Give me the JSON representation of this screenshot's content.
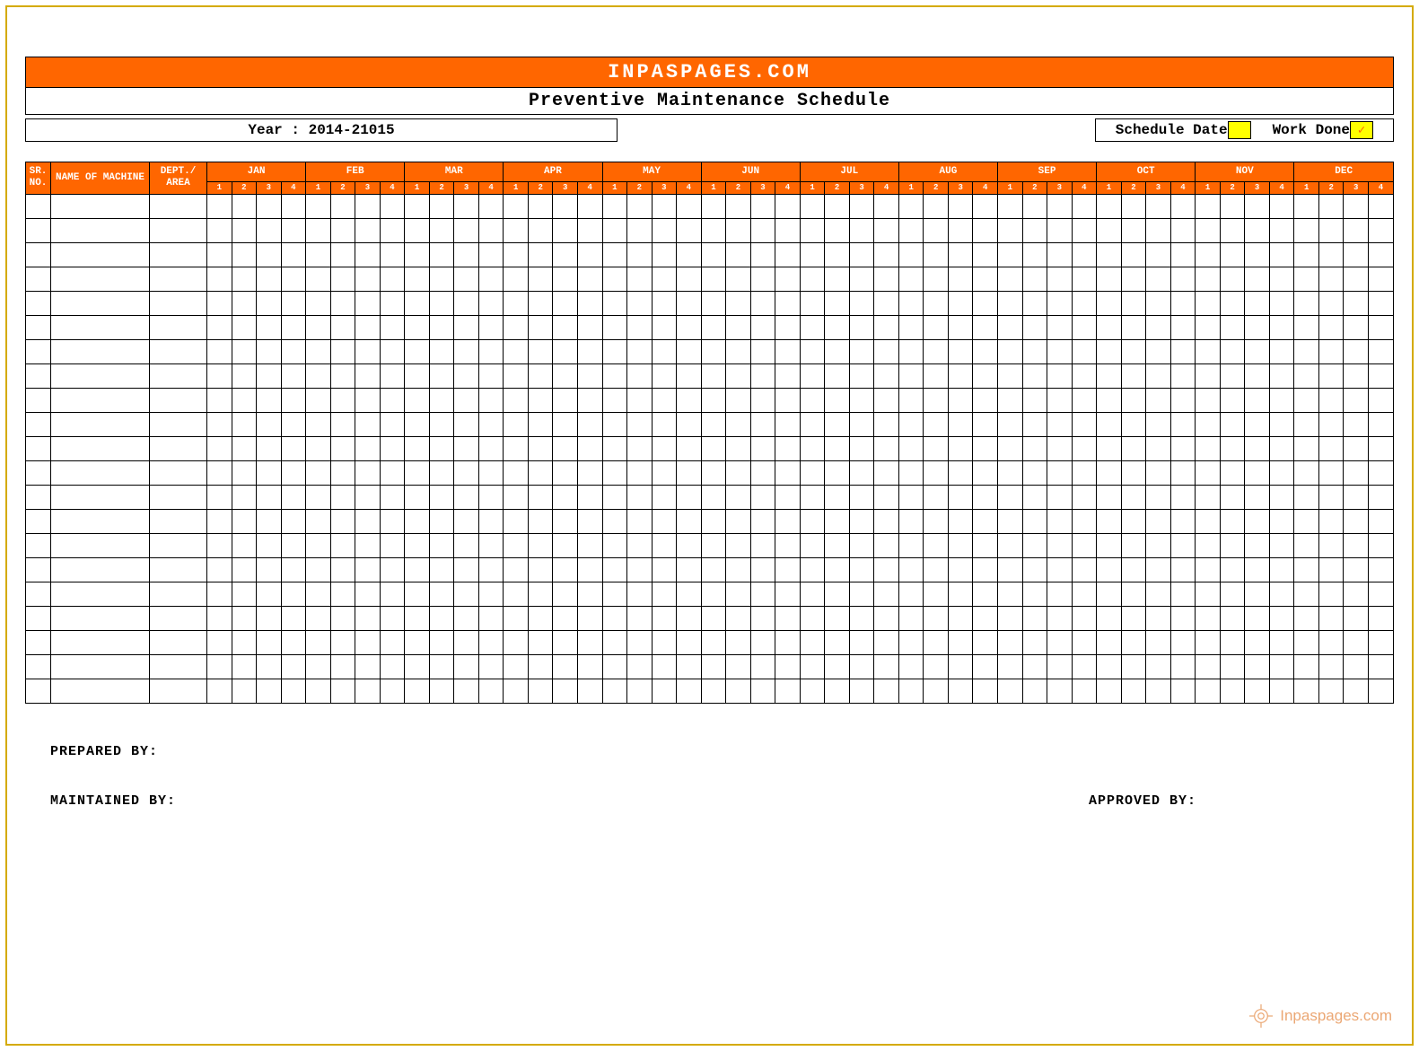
{
  "banner": "INPASPAGES.COM",
  "title": "Preventive Maintenance Schedule",
  "year_label": "Year : 2014-21015",
  "legend": {
    "schedule": "Schedule Date",
    "done": "Work Done"
  },
  "headers": {
    "sr": "SR. NO.",
    "machine": "NAME OF MACHINE",
    "dept": "DEPT./ AREA"
  },
  "months": [
    "JAN",
    "FEB",
    "MAR",
    "APR",
    "MAY",
    "JUN",
    "JUL",
    "AUG",
    "SEP",
    "OCT",
    "NOV",
    "DEC"
  ],
  "weeks": [
    "1",
    "2",
    "3",
    "4"
  ],
  "row_count": 21,
  "footer": {
    "prepared": "PREPARED BY:",
    "maintained": "MAINTAINED BY:",
    "approved": "APPROVED BY:"
  },
  "watermark": "Inpaspages.com"
}
